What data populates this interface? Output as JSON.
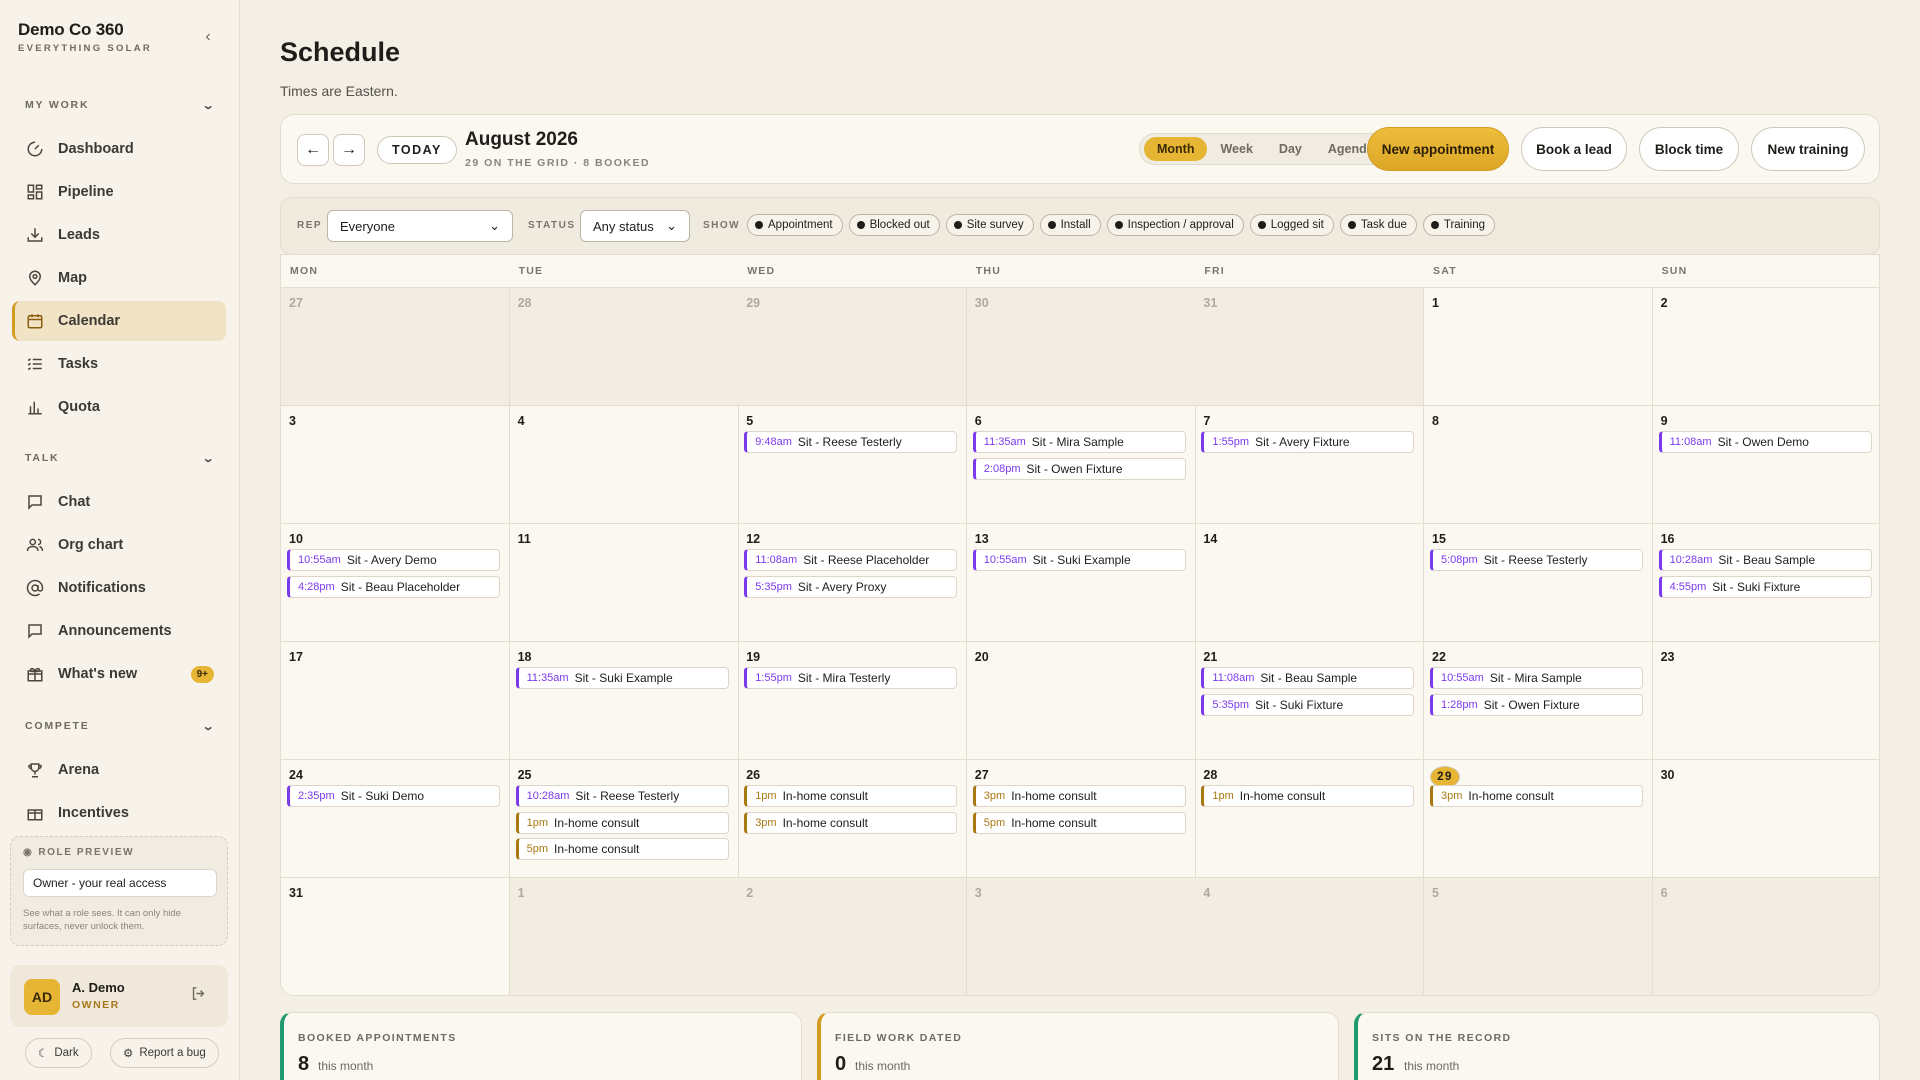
{
  "sidebar": {
    "brand": "Demo Co 360",
    "tagline": "EVERYTHING SOLAR",
    "sections": {
      "work": "MY WORK",
      "talk": "TALK",
      "compete": "COMPETE"
    },
    "nav": {
      "dashboard": "Dashboard",
      "pipeline": "Pipeline",
      "leads": "Leads",
      "map": "Map",
      "calendar": "Calendar",
      "tasks": "Tasks",
      "quota": "Quota",
      "chat": "Chat",
      "orgchart": "Org chart",
      "notifications": "Notifications",
      "announcements": "Announcements",
      "whatsnew": "What's new",
      "whatsnew_badge": "9+",
      "arena": "Arena",
      "incentives": "Incentives"
    },
    "role_preview": {
      "heading": "ROLE PREVIEW",
      "value": "Owner - your real access",
      "note": "See what a role sees. It can only hide surfaces, never unlock them."
    },
    "user": {
      "initials": "AD",
      "name": "A. Demo",
      "role": "OWNER"
    },
    "dark_label": "Dark",
    "bug_label": "Report a bug"
  },
  "header": {
    "title": "Schedule",
    "subtitle": "Times are Eastern."
  },
  "toolbar": {
    "prev": "←",
    "next": "→",
    "today": "TODAY",
    "month": "August 2026",
    "month_sub": "29 ON THE GRID · 8 BOOKED",
    "views": [
      "Month",
      "Week",
      "Day",
      "Agenda"
    ],
    "active_view": "Month",
    "actions": {
      "new_appt": "New appointment",
      "book_lead": "Book a lead",
      "block_time": "Block time",
      "new_training": "New training"
    }
  },
  "filters": {
    "rep_label": "REP",
    "rep_value": "Everyone",
    "status_label": "STATUS",
    "status_value": "Any status",
    "show_label": "SHOW",
    "chips": [
      "Appointment",
      "Blocked out",
      "Site survey",
      "Install",
      "Inspection / approval",
      "Logged sit",
      "Task due",
      "Training"
    ]
  },
  "calendar": {
    "weekdays": [
      "MON",
      "TUE",
      "WED",
      "THU",
      "FRI",
      "SAT",
      "SUN"
    ],
    "today_day": "29",
    "weeks": [
      [
        {
          "d": "27",
          "out": true,
          "ev": []
        },
        {
          "d": "28",
          "out": true,
          "ev": []
        },
        {
          "d": "29",
          "out": true,
          "ev": []
        },
        {
          "d": "30",
          "out": true,
          "ev": []
        },
        {
          "d": "31",
          "out": true,
          "ev": []
        },
        {
          "d": "1",
          "ev": []
        },
        {
          "d": "2",
          "ev": []
        }
      ],
      [
        {
          "d": "3",
          "ev": []
        },
        {
          "d": "4",
          "ev": []
        },
        {
          "d": "5",
          "ev": [
            {
              "t": "9:48am",
              "x": "Sit - Reese Testerly"
            }
          ]
        },
        {
          "d": "6",
          "ev": [
            {
              "t": "11:35am",
              "x": "Sit - Mira Sample"
            },
            {
              "t": "2:08pm",
              "x": "Sit - Owen Fixture"
            }
          ]
        },
        {
          "d": "7",
          "ev": [
            {
              "t": "1:55pm",
              "x": "Sit - Avery Fixture"
            }
          ]
        },
        {
          "d": "8",
          "ev": []
        },
        {
          "d": "9",
          "ev": [
            {
              "t": "11:08am",
              "x": "Sit - Owen Demo"
            }
          ]
        }
      ],
      [
        {
          "d": "10",
          "ev": [
            {
              "t": "10:55am",
              "x": "Sit - Avery Demo"
            },
            {
              "t": "4:28pm",
              "x": "Sit - Beau Placeholder"
            }
          ]
        },
        {
          "d": "11",
          "ev": []
        },
        {
          "d": "12",
          "ev": [
            {
              "t": "11:08am",
              "x": "Sit - Reese Placeholder"
            },
            {
              "t": "5:35pm",
              "x": "Sit - Avery Proxy"
            }
          ]
        },
        {
          "d": "13",
          "ev": [
            {
              "t": "10:55am",
              "x": "Sit - Suki Example"
            }
          ]
        },
        {
          "d": "14",
          "ev": []
        },
        {
          "d": "15",
          "ev": [
            {
              "t": "5:08pm",
              "x": "Sit - Reese Testerly"
            }
          ]
        },
        {
          "d": "16",
          "ev": [
            {
              "t": "10:28am",
              "x": "Sit - Beau Sample"
            },
            {
              "t": "4:55pm",
              "x": "Sit - Suki Fixture"
            }
          ]
        }
      ],
      [
        {
          "d": "17",
          "ev": []
        },
        {
          "d": "18",
          "ev": [
            {
              "t": "11:35am",
              "x": "Sit - Suki Example"
            }
          ]
        },
        {
          "d": "19",
          "ev": [
            {
              "t": "1:55pm",
              "x": "Sit - Mira Testerly"
            }
          ]
        },
        {
          "d": "20",
          "ev": []
        },
        {
          "d": "21",
          "ev": [
            {
              "t": "11:08am",
              "x": "Sit - Beau Sample"
            },
            {
              "t": "5:35pm",
              "x": "Sit - Suki Fixture"
            }
          ]
        },
        {
          "d": "22",
          "ev": [
            {
              "t": "10:55am",
              "x": "Sit - Mira Sample"
            },
            {
              "t": "1:28pm",
              "x": "Sit - Owen Fixture"
            }
          ]
        },
        {
          "d": "23",
          "ev": []
        }
      ],
      [
        {
          "d": "24",
          "ev": [
            {
              "t": "2:35pm",
              "x": "Sit - Suki Demo"
            }
          ]
        },
        {
          "d": "25",
          "ev": [
            {
              "t": "10:28am",
              "x": "Sit - Reese Testerly"
            },
            {
              "t": "1pm",
              "x": "In-home consult",
              "g": true
            },
            {
              "t": "5pm",
              "x": "In-home consult",
              "g": true
            }
          ]
        },
        {
          "d": "26",
          "ev": [
            {
              "t": "1pm",
              "x": "In-home consult",
              "g": true
            },
            {
              "t": "3pm",
              "x": "In-home consult",
              "g": true
            }
          ]
        },
        {
          "d": "27",
          "ev": [
            {
              "t": "3pm",
              "x": "In-home consult",
              "g": true
            },
            {
              "t": "5pm",
              "x": "In-home consult",
              "g": true
            }
          ]
        },
        {
          "d": "28",
          "ev": [
            {
              "t": "1pm",
              "x": "In-home consult",
              "g": true
            }
          ]
        },
        {
          "d": "29",
          "ev": [
            {
              "t": "3pm",
              "x": "In-home consult",
              "g": true
            }
          ]
        },
        {
          "d": "30",
          "ev": []
        }
      ],
      [
        {
          "d": "31",
          "ev": []
        },
        {
          "d": "1",
          "out": true,
          "ev": []
        },
        {
          "d": "2",
          "out": true,
          "ev": []
        },
        {
          "d": "3",
          "out": true,
          "ev": []
        },
        {
          "d": "4",
          "out": true,
          "ev": []
        },
        {
          "d": "5",
          "out": true,
          "ev": []
        },
        {
          "d": "6",
          "out": true,
          "ev": []
        }
      ]
    ]
  },
  "stats": [
    {
      "label": "BOOKED APPOINTMENTS",
      "value": "8",
      "unit": "this month"
    },
    {
      "label": "FIELD WORK DATED",
      "value": "0",
      "unit": "this month"
    },
    {
      "label": "SITS ON THE RECORD",
      "value": "21",
      "unit": "this month"
    }
  ]
}
